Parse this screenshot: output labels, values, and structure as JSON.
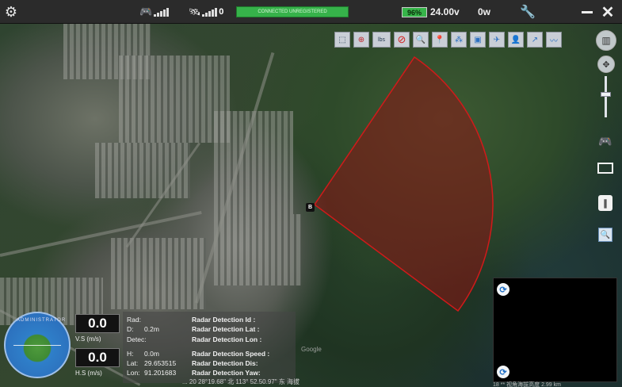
{
  "topbar": {
    "conn_status": "CONNECTED UNREGISTERED",
    "img_signal_count": "0",
    "battery": "96%",
    "voltage": "24.00v",
    "power": "0w",
    "battery_color": "#37b54a",
    "conn_color": "#36b24a"
  },
  "toolbar": {
    "tools": [
      "select-icon",
      "target-icon",
      "measure-label",
      "no-fly-icon",
      "search-icon",
      "waypoint-icon",
      "cluster-icon",
      "camera-icon",
      "aircraft-icon",
      "user-icon",
      "route-icon",
      "trend-icon"
    ],
    "measure_label": "lbs"
  },
  "map": {
    "marker_label": "B",
    "radar_fill": "#8b1414",
    "radar_stroke": "#d11a1a",
    "watermark": "Google",
    "coord_text": "... 20 28°19.68\" 北 113° 52.50.97\" 东 海拔",
    "coord_text2": "18 ** 视角海拔高度 2.99 km"
  },
  "telemetry": {
    "vs_value": "0.0",
    "vs_label": "V.S (m/s)",
    "hs_value": "0.0",
    "hs_label": "H.S (m/s)",
    "rad_label": "Rad:",
    "d_label": "D:",
    "d_value": "0.2m",
    "detec_label": "Detec:",
    "h_label": "H:",
    "h_value": "0.0m",
    "lat_label": "Lat:",
    "lat_value": "29.653515",
    "lon_label": "Lon:",
    "lon_value": "91.201683",
    "radar_id": "Radar Detection Id :",
    "radar_lat": "Radar Detection Lat :",
    "radar_lon": "Radar Detection Lon :",
    "radar_speed": "Radar Detection Speed :",
    "radar_dis": "Radar Detection Dis:",
    "radar_yaw": "Radar Detection Yaw:",
    "compass_text": "ADMINISTRATOR"
  }
}
